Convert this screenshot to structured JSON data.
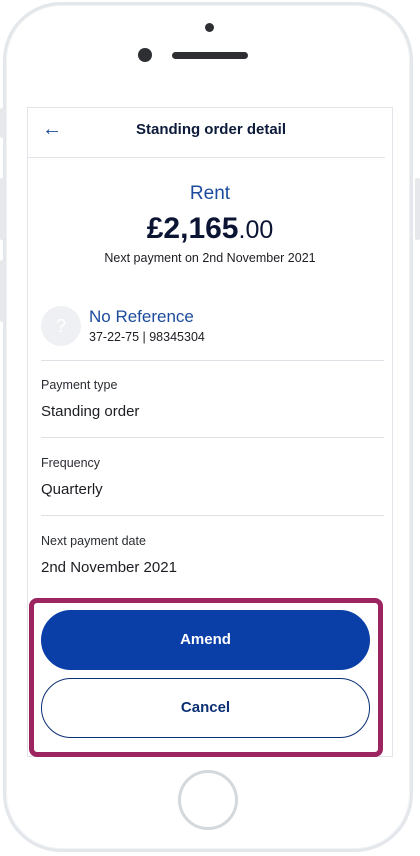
{
  "header": {
    "back_glyph": "←",
    "title": "Standing order detail"
  },
  "summary": {
    "payee": "Rent",
    "amount_main": "£2,165",
    "amount_pence": ".00",
    "next_payment_text": "Next payment on 2nd November 2021"
  },
  "recipient": {
    "avatar_glyph": "?",
    "reference": "No Reference",
    "account_details": "37-22-75 | 98345304"
  },
  "fields": [
    {
      "label": "Payment type",
      "value": "Standing order"
    },
    {
      "label": "Frequency",
      "value": "Quarterly"
    },
    {
      "label": "Next payment date",
      "value": "2nd November 2021"
    }
  ],
  "actions": {
    "amend_label": "Amend",
    "cancel_label": "Cancel"
  },
  "colors": {
    "accent": "#1c4b9e",
    "primary_button": "#0a3fa8",
    "highlight_border": "#9c2561"
  },
  "icons": {
    "back": "arrow-left-icon",
    "avatar": "question-mark-icon"
  }
}
